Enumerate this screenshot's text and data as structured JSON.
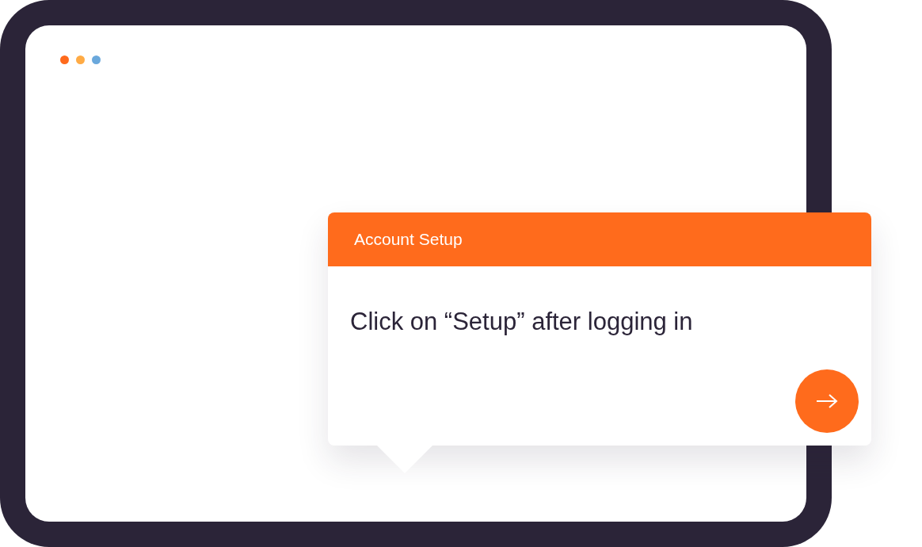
{
  "window": {
    "controls": [
      {
        "color": "#ff6a1c"
      },
      {
        "color": "#ffab45"
      },
      {
        "color": "#6aa8dc"
      }
    ]
  },
  "tooltip": {
    "title": "Account Setup",
    "message": "Click on “Setup” after logging in"
  }
}
